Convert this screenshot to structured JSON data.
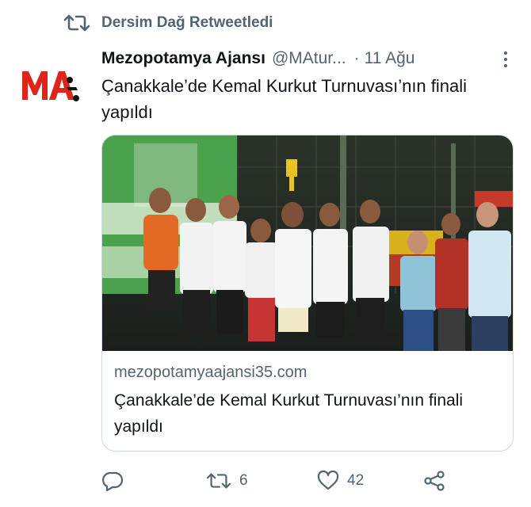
{
  "retweet_banner": {
    "text": "Dersim Dağ Retweetledi",
    "icon": "retweet-icon"
  },
  "tweet": {
    "author": {
      "name": "Mezopotamya Ajansı",
      "handle": "@MAtur...",
      "avatar_text": "MA",
      "avatar_color": "#e0231b"
    },
    "separator": "·",
    "time": "11 Ağu",
    "text": "Çanakkale’de Kemal Kurkut Turnuvası’nın finali yapıldı"
  },
  "card": {
    "domain": "mezopotamyaajansi35.com",
    "title": "Çanakkale’de Kemal Kurkut Turnuvası’nın finali yapıldı"
  },
  "actions": {
    "reply": {
      "icon": "reply-icon",
      "count": ""
    },
    "retweet": {
      "icon": "retweet-icon",
      "count": "6"
    },
    "like": {
      "icon": "heart-icon",
      "count": "42"
    },
    "share": {
      "icon": "share-icon"
    }
  },
  "colors": {
    "secondary_text": "#536471",
    "primary_text": "#0f1419",
    "brand_red": "#e0231b",
    "border": "#cfd9de"
  }
}
